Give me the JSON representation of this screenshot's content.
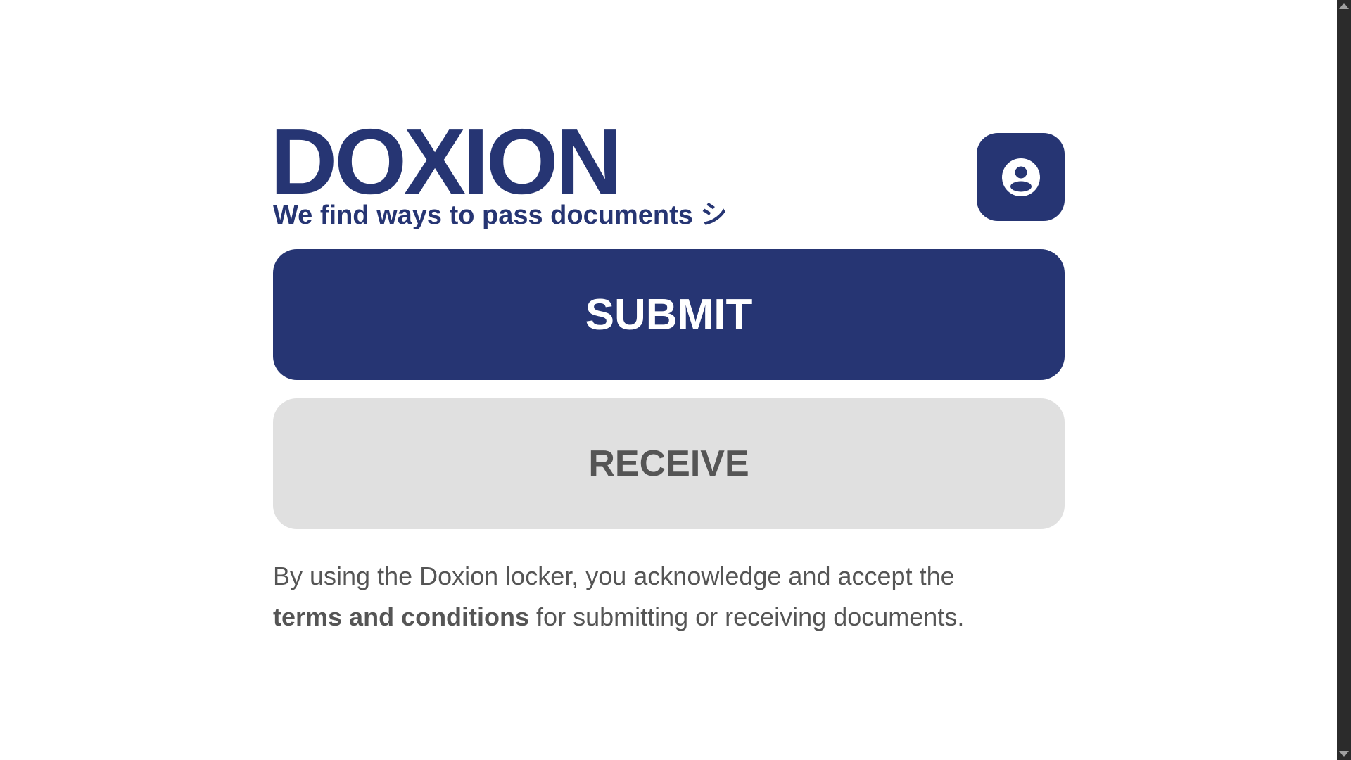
{
  "brand": {
    "title": "DOXION",
    "tagline": "We find ways to pass documents シ"
  },
  "profile": {
    "icon": "account-circle-icon"
  },
  "actions": {
    "submit_label": "SUBMIT",
    "receive_label": "RECEIVE"
  },
  "terms": {
    "prefix": "By using the Doxion locker, you acknowledge and accept the ",
    "link_text": "terms and conditions",
    "suffix": " for submitting or receiving documents."
  },
  "colors": {
    "primary": "#263573",
    "secondary_bg": "#e0e0e0",
    "secondary_text": "#555555",
    "background": "#ffffff"
  },
  "scrollbar": {
    "up_icon": "scroll-up-arrow-icon",
    "down_icon": "scroll-down-arrow-icon"
  }
}
